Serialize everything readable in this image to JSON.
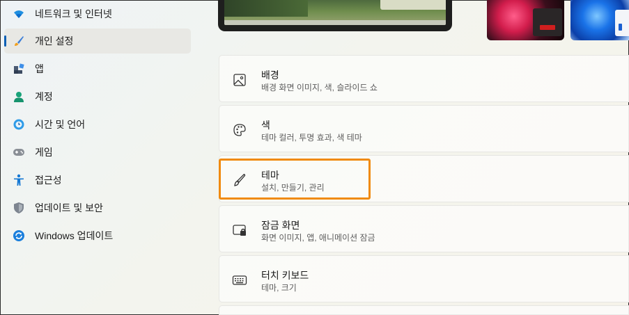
{
  "sidebar": {
    "items": [
      {
        "label": "네트워크 및 인터넷",
        "icon": "wifi-icon"
      },
      {
        "label": "개인 설정",
        "icon": "brush-icon",
        "selected": true
      },
      {
        "label": "앱",
        "icon": "apps-icon"
      },
      {
        "label": "계정",
        "icon": "person-icon"
      },
      {
        "label": "시간 및 언어",
        "icon": "globe-clock-icon"
      },
      {
        "label": "게임",
        "icon": "gamepad-icon"
      },
      {
        "label": "접근성",
        "icon": "accessibility-icon"
      },
      {
        "label": "업데이트 및 보안",
        "icon": "shield-icon"
      },
      {
        "label": "Windows 업데이트",
        "icon": "sync-icon"
      }
    ]
  },
  "cards": [
    {
      "title": "배경",
      "desc": "배경 화면 이미지, 색, 슬라이드 쇼",
      "icon": "picture-icon"
    },
    {
      "title": "색",
      "desc": "테마 컬러, 투명 효과, 색 테마",
      "icon": "palette-icon"
    },
    {
      "title": "테마",
      "desc": "설치, 만들기, 관리",
      "icon": "brush-icon"
    },
    {
      "title": "잠금 화면",
      "desc": "화면 이미지, 앱, 애니메이션 잠금",
      "icon": "lock-screen-icon"
    },
    {
      "title": "터치 키보드",
      "desc": "테마, 크기",
      "icon": "keyboard-icon"
    }
  ],
  "colors": {
    "accent": "#0a5fb4",
    "highlight": "#f08a0e"
  }
}
